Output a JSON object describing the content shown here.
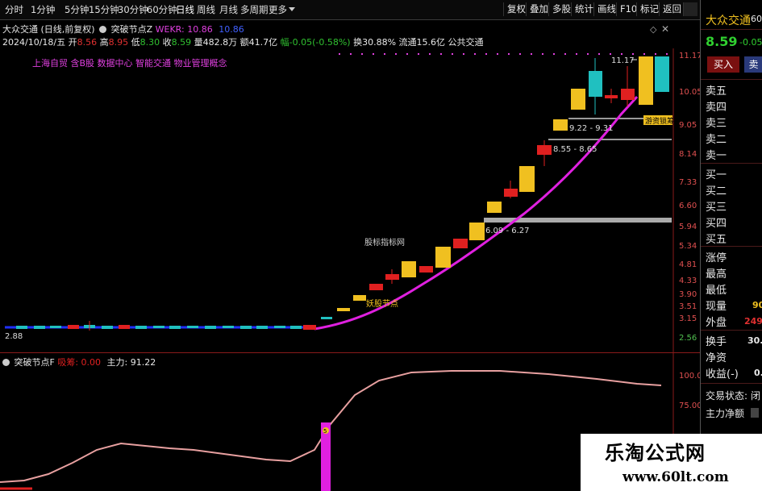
{
  "toolbar": {
    "items": [
      "分时",
      "1分钟",
      "5分钟",
      "15分钟",
      "30分钟",
      "60分钟",
      "日线",
      "周线",
      "月线",
      "多周期",
      "更多"
    ],
    "right_items": [
      "复权",
      "叠加",
      "多股",
      "统计",
      "画线",
      "F10",
      "标记",
      "返回"
    ]
  },
  "info": {
    "stock_name": "大众交通",
    "period_label": "(日线,前复权)",
    "indicator_name": "突破节点Z",
    "wekr_label": "WEKR:",
    "wekr_value": "10.86",
    "wekr_value2": "10.86",
    "date": "2024/10/18/五",
    "open_label": "开",
    "open": "8.56",
    "high_label": "高",
    "high": "8.95",
    "low_label": "低",
    "low": "8.30",
    "close_label": "收",
    "close": "8.59",
    "volume": "量482.8万",
    "amount": "额41.7亿",
    "change": "幅-0.05(-0.58%)",
    "turnover": "换30.88%",
    "float": "流通15.6亿",
    "sector": "公共交通",
    "concepts": "上海自贸 含B股 数据中心 智能交通 物业管理概念"
  },
  "chart": {
    "price_ticks": [
      "11.17",
      "10.05",
      "9.05",
      "8.14",
      "7.33",
      "6.60",
      "5.94",
      "5.34",
      "4.81",
      "4.33",
      "3.90",
      "3.51",
      "3.15",
      "2.56"
    ],
    "annotations": {
      "high_price": "11.17",
      "low_price": "2.88",
      "range1": "9.22 - 9.31",
      "range2": "8.55 - 8.65",
      "range3": "6.09 - 6.27",
      "label_watermark": "股标指标网",
      "label_node": "妖股节点",
      "label_right": "游资锁筹"
    }
  },
  "sub": {
    "indicator": "突破节点F",
    "hint_label": "吸筹:",
    "hint_value": "0.00",
    "main_label": "主力:",
    "main_value": "91.22",
    "ticks": [
      "100.0",
      "75.00"
    ],
    "marker": "5"
  },
  "right_panel": {
    "name": "大众交通",
    "code_prefix": "60",
    "price": "8.59",
    "change": "-0.05",
    "buy_btn": "买入",
    "sell_btn": "卖",
    "sell_rows": [
      "卖五",
      "卖四",
      "卖三",
      "卖二",
      "卖一"
    ],
    "buy_rows": [
      "买一",
      "买二",
      "买三",
      "买四",
      "买五"
    ],
    "stats": [
      "涨停",
      "最高",
      "最低",
      "现量",
      "外盘"
    ],
    "stat_vals": [
      "",
      "",
      "",
      "90",
      "249"
    ],
    "stats2": [
      "换手",
      "净资",
      "收益(-)"
    ],
    "stat2_vals": [
      "30.",
      "",
      "0."
    ],
    "trade_status_label": "交易状态:",
    "trade_status_val": "闭",
    "net_label": "主力净额"
  },
  "watermark": {
    "line1": "乐淘公式网",
    "line2": "www.60lt.com"
  },
  "colors": {
    "up": "#e02020",
    "down": "#20c0c0",
    "yellow": "#f0c020",
    "magenta": "#e020e0",
    "blue": "#2030ff"
  }
}
